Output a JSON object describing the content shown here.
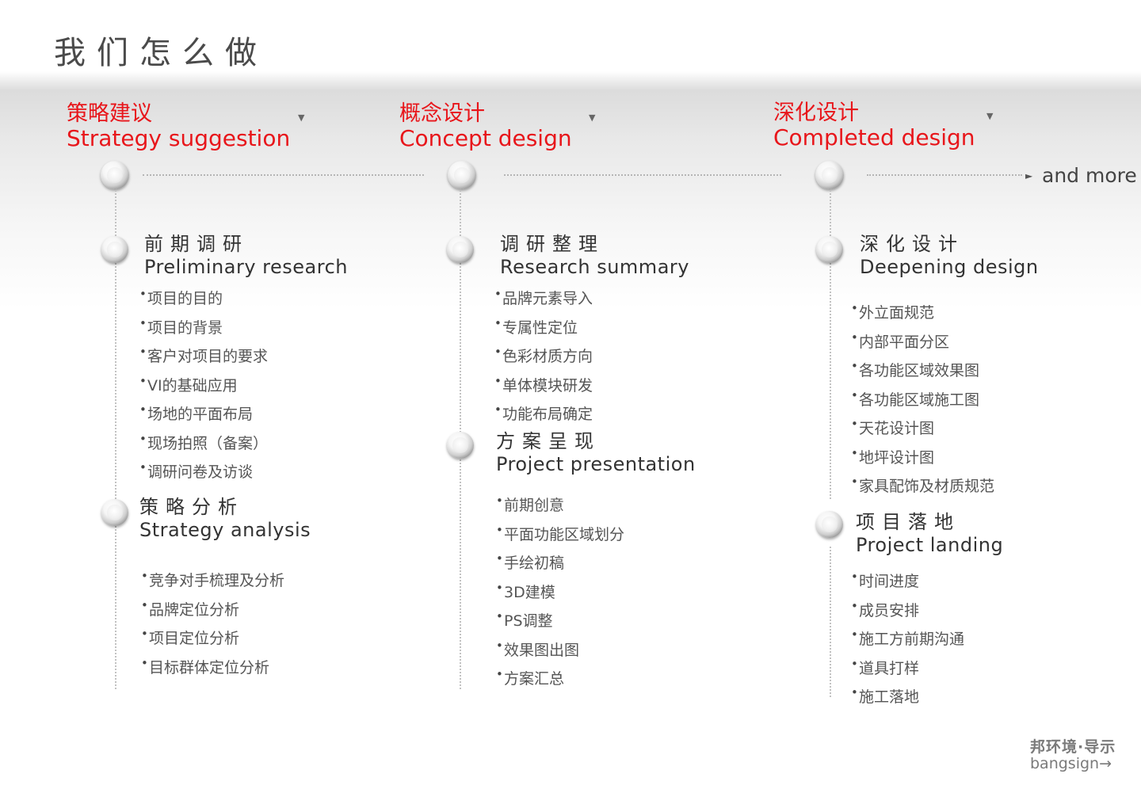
{
  "title": "我们怎么做",
  "phases": [
    {
      "cn": "策略建议",
      "en": "Strategy suggestion"
    },
    {
      "cn": "概念设计",
      "en": "Concept design"
    },
    {
      "cn": "深化设计",
      "en": "Completed design"
    }
  ],
  "and_more": "and more",
  "columns": [
    {
      "sections": [
        {
          "cn": "前期调研",
          "en": "Preliminary research",
          "items": [
            "项目的目的",
            "项目的背景",
            "客户对项目的要求",
            "VI的基础应用",
            "场地的平面布局",
            "现场拍照（备案）",
            "调研问卷及访谈"
          ]
        },
        {
          "cn": "策略分析",
          "en": "Strategy  analysis",
          "items": [
            "竞争对手梳理及分析",
            "品牌定位分析",
            "项目定位分析",
            "目标群体定位分析"
          ]
        }
      ]
    },
    {
      "sections": [
        {
          "cn": "调研整理",
          "en": "Research summary",
          "items": [
            "品牌元素导入",
            "专属性定位",
            "色彩材质方向",
            "单体模块研发",
            "功能布局确定"
          ]
        },
        {
          "cn": "方案呈现",
          "en": "Project presentation",
          "items": [
            "前期创意",
            "平面功能区域划分",
            "手绘初稿",
            "3D建模",
            "PS调整",
            "效果图出图",
            "方案汇总"
          ]
        }
      ]
    },
    {
      "sections": [
        {
          "cn": "深化设计",
          "en": "Deepening design",
          "items": [
            "外立面规范",
            "内部平面分区",
            "各功能区域效果图",
            "各功能区域施工图",
            "天花设计图",
            "地坪设计图",
            "家具配饰及材质规范"
          ]
        },
        {
          "cn": "项目落地",
          "en": "Project  landing",
          "items": [
            "时间进度",
            "成员安排",
            "施工方前期沟通",
            "道具打样",
            "施工落地"
          ]
        }
      ]
    }
  ],
  "logo": {
    "line1": "邦环境·导示",
    "line2": "bangsign→"
  }
}
